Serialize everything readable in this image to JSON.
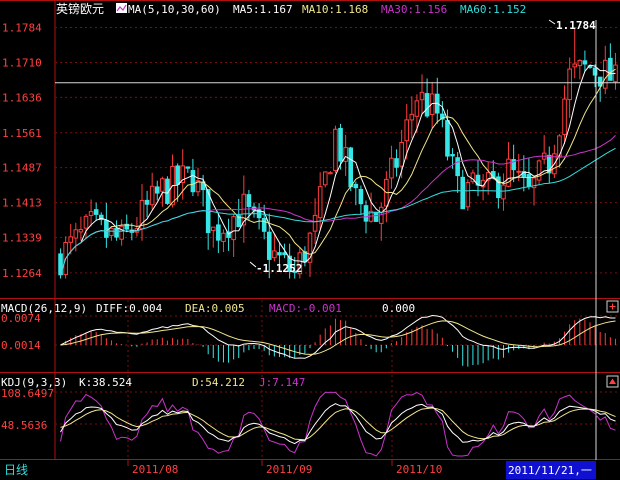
{
  "symbol": "英镑欧元",
  "colors": {
    "background": "#000000",
    "up": "#ff3c3c",
    "down": "#35e6e6",
    "ma5": "#ffffff",
    "ma10": "#f0e68c",
    "ma30": "#cc33cc",
    "ma60": "#33dddd",
    "frame": "#b01010",
    "axis_text": "#ff4040",
    "k_line": "#ffffff",
    "d_line": "#f0e68c",
    "j_line": "#cc33cc",
    "selected_date_bg": "#1010d0"
  },
  "price_panel": {
    "ma_legend": {
      "ma_set": "MA(5,10,30,60)",
      "ma5": "MA5:1.167",
      "ma10": "MA10:1.168",
      "ma30": "MA30:1.156",
      "ma60": "MA60:1.152"
    },
    "y_ticks": [
      "1.1784",
      "1.1710",
      "1.1636",
      "1.1561",
      "1.1487",
      "1.1413",
      "1.1339",
      "1.1264"
    ],
    "high_label": "1.1784",
    "low_label": "-1.1252",
    "crosshair_price": 1.1667
  },
  "macd_panel": {
    "title": "MACD(26,12,9)",
    "diff": "DIFF:0.004",
    "dea": "DEA:0.005",
    "macd": "MACD:-0.001",
    "extra": "0.000",
    "y_ticks": [
      "0.0074",
      "0.0014"
    ]
  },
  "kdj_panel": {
    "title": "KDJ(9,3,3)",
    "k": "K:38.524",
    "d": "D:54.212",
    "j": "J:7.147",
    "y_ticks": [
      "108.6497",
      "48.5636"
    ]
  },
  "bottom_bar": {
    "period_tab": "日线",
    "dates": [
      "2011/08",
      "2011/09",
      "2011/10"
    ],
    "selected_date": "2011/11/21,一"
  },
  "icons": {
    "legend_icon": "ma-legend-icon",
    "macd_toggle": "plus-icon",
    "kdj_toggle": "up-arrow-icon"
  }
}
